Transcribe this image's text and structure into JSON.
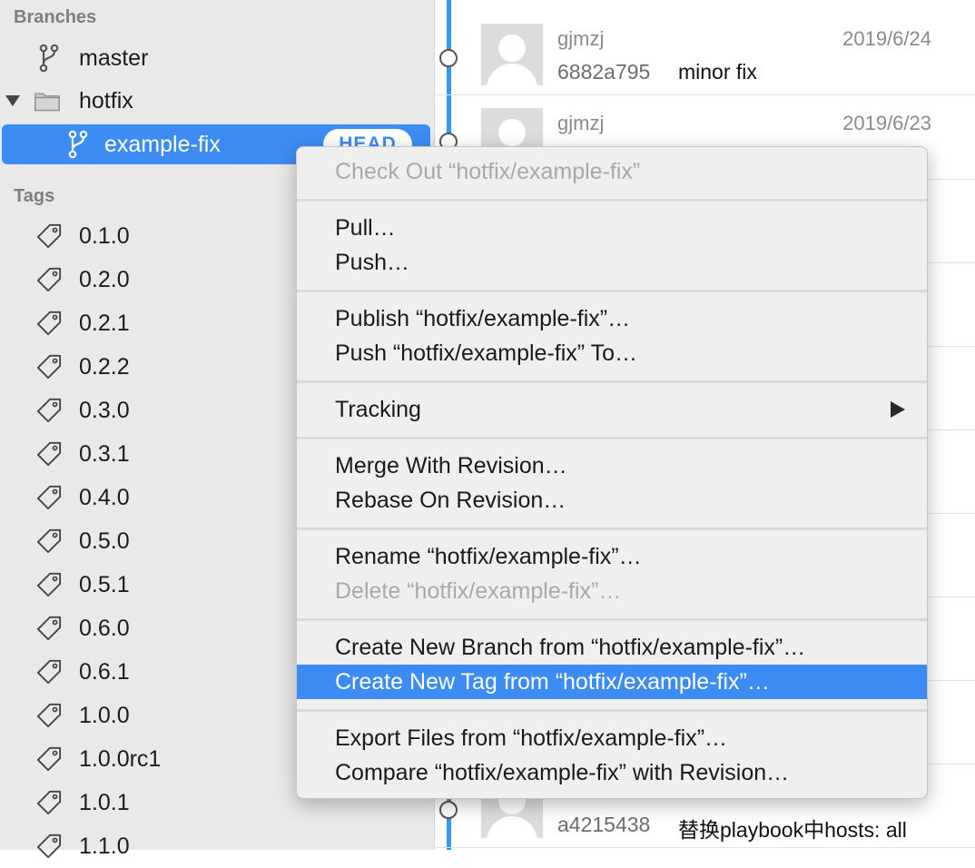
{
  "sidebar": {
    "branches_header": "Branches",
    "tags_header": "Tags",
    "branches": [
      {
        "label": "master"
      },
      {
        "label": "hotfix"
      },
      {
        "label": "example-fix",
        "badge": "HEAD"
      }
    ],
    "tags": [
      "0.1.0",
      "0.2.0",
      "0.2.1",
      "0.2.2",
      "0.3.0",
      "0.3.1",
      "0.4.0",
      "0.5.0",
      "0.5.1",
      "0.6.0",
      "0.6.1",
      "1.0.0",
      "1.0.0rc1",
      "1.0.1",
      "1.1.0"
    ]
  },
  "commits": [
    {
      "author": "gjmzj",
      "date": "2019/6/24",
      "hash": "6882a795",
      "message": "minor fix"
    },
    {
      "author": "gjmzj",
      "date": "2019/6/23",
      "hash": "",
      "message": ""
    },
    {
      "author": "",
      "date": "",
      "hash": "a4215438",
      "message": "替换playbook中hosts: all"
    }
  ],
  "context_menu": {
    "items": [
      {
        "label": "Check Out “hotfix/example-fix”",
        "enabled": false
      },
      {
        "label": "Pull…",
        "enabled": true
      },
      {
        "label": "Push…",
        "enabled": true
      },
      {
        "label": "Publish “hotfix/example-fix”…",
        "enabled": true
      },
      {
        "label": "Push “hotfix/example-fix” To…",
        "enabled": true
      },
      {
        "label": "Tracking",
        "enabled": true,
        "submenu": true
      },
      {
        "label": "Merge With Revision…",
        "enabled": true
      },
      {
        "label": "Rebase On Revision…",
        "enabled": true
      },
      {
        "label": "Rename “hotfix/example-fix”…",
        "enabled": true
      },
      {
        "label": "Delete “hotfix/example-fix”…",
        "enabled": false
      },
      {
        "label": "Create New Branch from “hotfix/example-fix”…",
        "enabled": true
      },
      {
        "label": "Create New Tag from “hotfix/example-fix”…",
        "enabled": true,
        "highlighted": true
      },
      {
        "label": "Export Files from “hotfix/example-fix”…",
        "enabled": true
      },
      {
        "label": "Compare “hotfix/example-fix” with Revision…",
        "enabled": true
      }
    ]
  },
  "colors": {
    "accent": "#3d8cf4",
    "graph_line": "#2d9bf0",
    "disabled_text": "#a9a9ab"
  }
}
